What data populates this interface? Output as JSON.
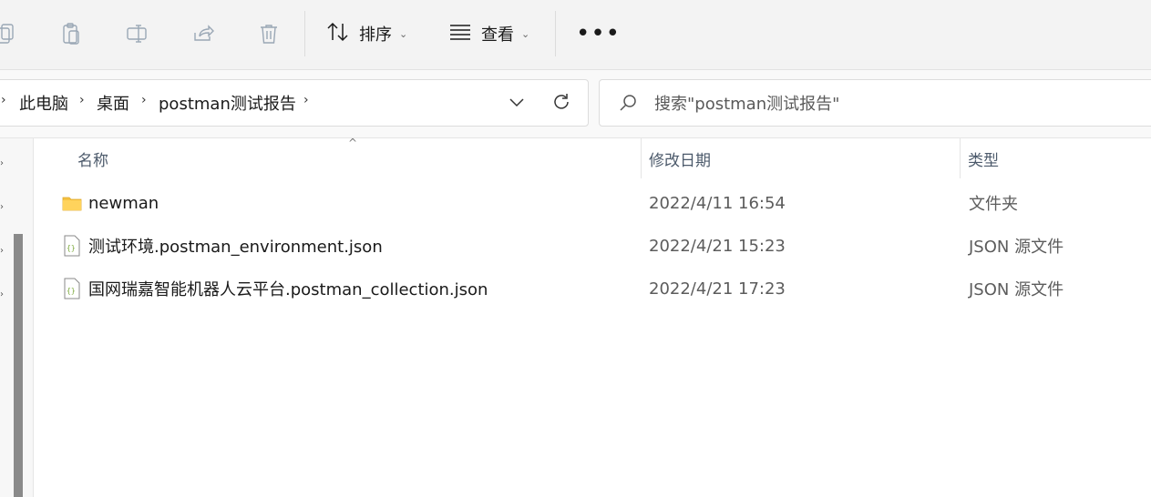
{
  "toolbar": {
    "icons": [
      "copy-icon",
      "paste-icon",
      "rename-icon",
      "share-icon",
      "delete-icon"
    ],
    "sort_label": "排序",
    "view_label": "查看",
    "more_label": "•••"
  },
  "address_bar": {
    "crumbs": [
      "此电脑",
      "桌面",
      "postman测试报告"
    ]
  },
  "search": {
    "placeholder": "搜索\"postman测试报告\""
  },
  "columns": {
    "name": "名称",
    "modified": "修改日期",
    "type": "类型"
  },
  "files": [
    {
      "name": "newman",
      "modified": "2022/4/11 16:54",
      "type": "文件夹",
      "icon": "folder-icon"
    },
    {
      "name": "测试环境.postman_environment.json",
      "modified": "2022/4/21 15:23",
      "type": "JSON 源文件",
      "icon": "json-file-icon"
    },
    {
      "name": "国网瑞嘉智能机器人云平台.postman_collection.json",
      "modified": "2022/4/21 17:23",
      "type": "JSON 源文件",
      "icon": "json-file-icon"
    }
  ],
  "colors": {
    "folder": "#f5c242",
    "header_text": "#4c5a6b"
  }
}
